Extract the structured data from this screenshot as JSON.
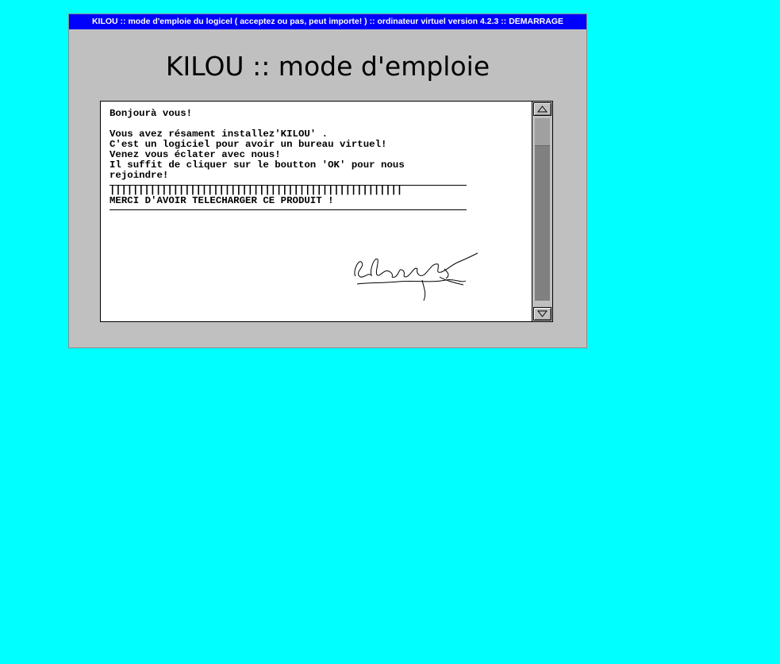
{
  "window": {
    "title": "KILOU :: mode d'emploie du logicel ( acceptez ou pas, peut importe! ) :: ordinateur virtuel version 4.2.3 :: DEMARRAGE",
    "heading": "KILOU :: mode d'emploie"
  },
  "message": {
    "greeting": "Bonjourà vous!",
    "lines": [
      "Vous avez résament installez'KILOU' .",
      "C'est un logiciel pour avoir un bureau virtuel!",
      "Venez vous éclater avec nous!",
      "Il suffit de cliquer sur le boutton 'OK' pour nous",
      "rejoindre!"
    ],
    "ticks": "|||||||||||||||||||||||||||||||||||||||||||||||||||",
    "thanks": "MERCI D'AVOIR TELECHARGER CE PRODUIT !"
  },
  "icons": {
    "scroll_up": "triangle-up-icon",
    "scroll_down": "triangle-down-icon",
    "signature": "handwritten-signature"
  },
  "colors": {
    "desktop": "#00ffff",
    "titlebar": "#0000ff",
    "window": "#c0c0c0",
    "scroll_track": "#808080"
  }
}
